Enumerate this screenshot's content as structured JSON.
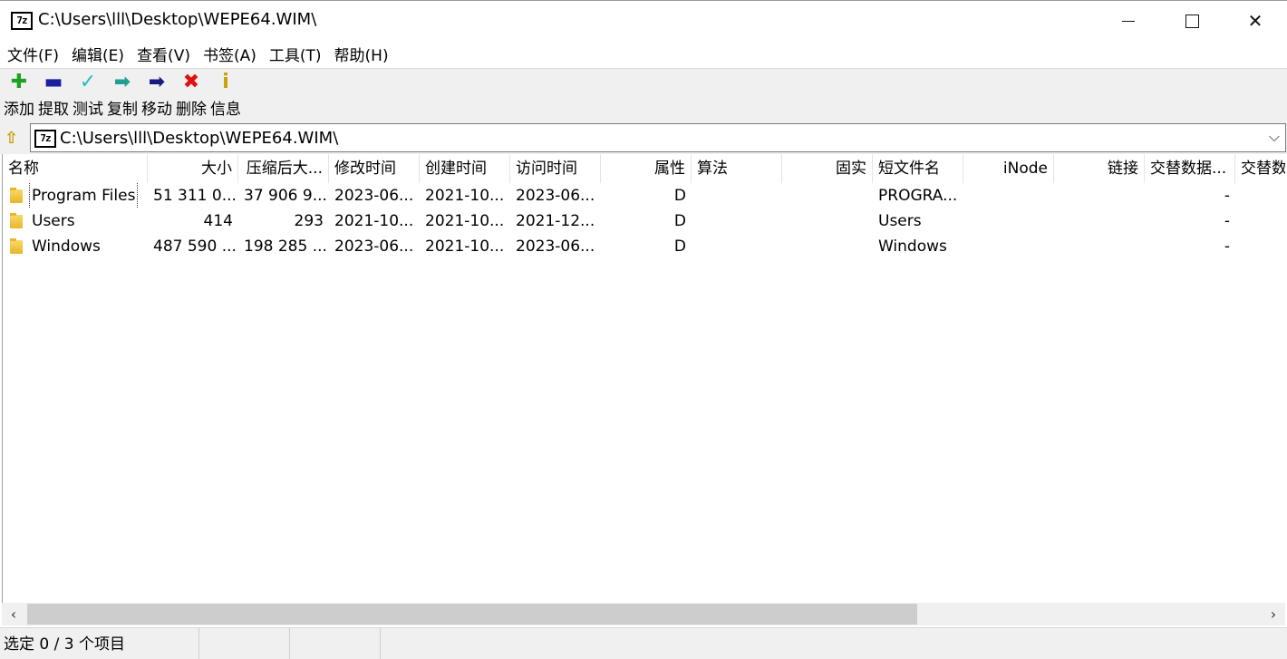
{
  "window": {
    "title": "C:\\Users\\lll\\Desktop\\WEPE64.WIM\\",
    "app_icon_text": "7z"
  },
  "menu": [
    "文件(F)",
    "编辑(E)",
    "查看(V)",
    "书签(A)",
    "工具(T)",
    "帮助(H)"
  ],
  "toolbar": [
    {
      "label": "添加",
      "icon": "plus-icon",
      "color": "#1fa01f",
      "glyph": "✚"
    },
    {
      "label": "提取",
      "icon": "minus-icon",
      "color": "#1e1ea0",
      "glyph": "▬"
    },
    {
      "label": "测试",
      "icon": "check-icon",
      "color": "#1ec0c0",
      "glyph": "✓"
    },
    {
      "label": "复制",
      "icon": "copy-arrow-icon",
      "color": "#20a090",
      "glyph": "➡"
    },
    {
      "label": "移动",
      "icon": "move-arrow-icon",
      "color": "#1a1a80",
      "glyph": "➡"
    },
    {
      "label": "删除",
      "icon": "delete-x-icon",
      "color": "#e01010",
      "glyph": "✖"
    },
    {
      "label": "信息",
      "icon": "info-icon",
      "color": "#c8a000",
      "glyph": "i"
    }
  ],
  "address": {
    "value": "C:\\Users\\lll\\Desktop\\WEPE64.WIM\\",
    "icon_text": "7z"
  },
  "columns": [
    "名称",
    "大小",
    "压缩后大...",
    "修改时间",
    "创建时间",
    "访问时间",
    "属性",
    "算法",
    "固实",
    "短文件名",
    "iNode",
    "链接",
    "交替数据...",
    "交替数"
  ],
  "rows": [
    {
      "name": "Program Files",
      "size": "51 311 0...",
      "packed": "37 906 9...",
      "modified": "2023-06...",
      "created": "2021-10...",
      "accessed": "2023-06...",
      "attr": "D",
      "method": "",
      "solid": "",
      "short_name": "PROGRA...",
      "inode": "",
      "links": "",
      "alt_streams": "-"
    },
    {
      "name": "Users",
      "size": "414",
      "packed": "293",
      "modified": "2021-10...",
      "created": "2021-10...",
      "accessed": "2021-12...",
      "attr": "D",
      "method": "",
      "solid": "",
      "short_name": "Users",
      "inode": "",
      "links": "",
      "alt_streams": "-"
    },
    {
      "name": "Windows",
      "size": "487 590 ...",
      "packed": "198 285 ...",
      "modified": "2023-06...",
      "created": "2021-10...",
      "accessed": "2023-06...",
      "attr": "D",
      "method": "",
      "solid": "",
      "short_name": "Windows",
      "inode": "",
      "links": "",
      "alt_streams": "-"
    }
  ],
  "status": {
    "selection": "选定 0 / 3 个项目",
    "cell2": "",
    "cell3": "",
    "cell4": ""
  }
}
